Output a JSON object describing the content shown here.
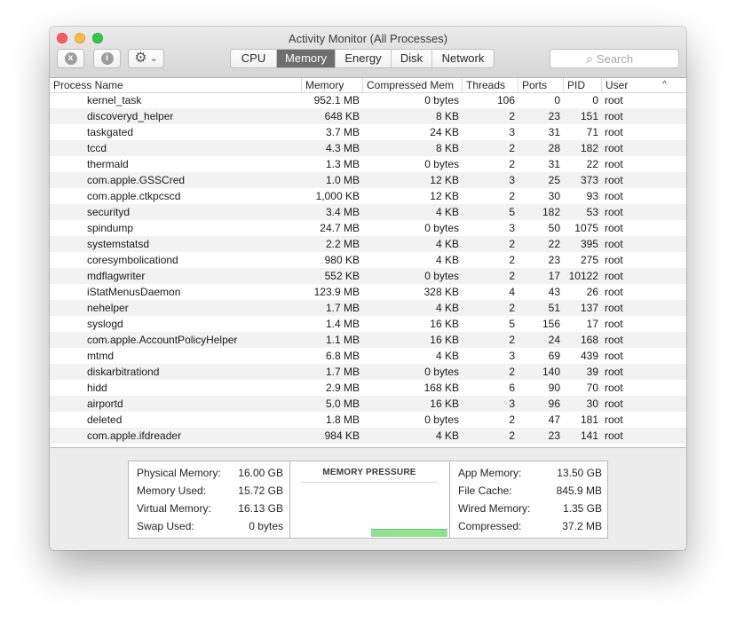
{
  "window": {
    "title": "Activity Monitor (All Processes)"
  },
  "toolbar": {
    "stop_icon": "x",
    "info_icon": "i",
    "gear_icon": "⚙",
    "gear_caret": "⌄",
    "tabs": [
      {
        "label": "CPU",
        "active": false
      },
      {
        "label": "Memory",
        "active": true
      },
      {
        "label": "Energy",
        "active": false
      },
      {
        "label": "Disk",
        "active": false
      },
      {
        "label": "Network",
        "active": false
      }
    ],
    "search": {
      "placeholder": "Search",
      "icon": "⌕"
    }
  },
  "table": {
    "columns": {
      "name": "Process Name",
      "memory": "Memory",
      "compressed": "Compressed Mem",
      "threads": "Threads",
      "ports": "Ports",
      "pid": "PID",
      "user": "User",
      "sort_indicator": "^"
    },
    "rows": [
      [
        "kernel_task",
        "952.1 MB",
        "0 bytes",
        "106",
        "0",
        "0",
        "root"
      ],
      [
        "discoveryd_helper",
        "648 KB",
        "8 KB",
        "2",
        "23",
        "151",
        "root"
      ],
      [
        "taskgated",
        "3.7 MB",
        "24 KB",
        "3",
        "31",
        "71",
        "root"
      ],
      [
        "tccd",
        "4.3 MB",
        "8 KB",
        "2",
        "28",
        "182",
        "root"
      ],
      [
        "thermald",
        "1.3 MB",
        "0 bytes",
        "2",
        "31",
        "22",
        "root"
      ],
      [
        "com.apple.GSSCred",
        "1.0 MB",
        "12 KB",
        "3",
        "25",
        "373",
        "root"
      ],
      [
        "com.apple.ctkpcscd",
        "1,000 KB",
        "12 KB",
        "2",
        "30",
        "93",
        "root"
      ],
      [
        "securityd",
        "3.4 MB",
        "4 KB",
        "5",
        "182",
        "53",
        "root"
      ],
      [
        "spindump",
        "24.7 MB",
        "0 bytes",
        "3",
        "50",
        "1075",
        "root"
      ],
      [
        "systemstatsd",
        "2.2 MB",
        "4 KB",
        "2",
        "22",
        "395",
        "root"
      ],
      [
        "coresymbolicationd",
        "980 KB",
        "4 KB",
        "2",
        "23",
        "275",
        "root"
      ],
      [
        "mdflagwriter",
        "552 KB",
        "0 bytes",
        "2",
        "17",
        "10122",
        "root"
      ],
      [
        "iStatMenusDaemon",
        "123.9 MB",
        "328 KB",
        "4",
        "43",
        "26",
        "root"
      ],
      [
        "nehelper",
        "1.7 MB",
        "4 KB",
        "2",
        "51",
        "137",
        "root"
      ],
      [
        "syslogd",
        "1.4 MB",
        "16 KB",
        "5",
        "156",
        "17",
        "root"
      ],
      [
        "com.apple.AccountPolicyHelper",
        "1.1 MB",
        "16 KB",
        "2",
        "24",
        "168",
        "root"
      ],
      [
        "mtmd",
        "6.8 MB",
        "4 KB",
        "3",
        "69",
        "439",
        "root"
      ],
      [
        "diskarbitrationd",
        "1.7 MB",
        "0 bytes",
        "2",
        "140",
        "39",
        "root"
      ],
      [
        "hidd",
        "2.9 MB",
        "168 KB",
        "6",
        "90",
        "70",
        "root"
      ],
      [
        "airportd",
        "5.0 MB",
        "16 KB",
        "3",
        "96",
        "30",
        "root"
      ],
      [
        "deleted",
        "1.8 MB",
        "0 bytes",
        "2",
        "47",
        "181",
        "root"
      ],
      [
        "com.apple.ifdreader",
        "984 KB",
        "4 KB",
        "2",
        "23",
        "141",
        "root"
      ]
    ]
  },
  "stats": {
    "left": [
      {
        "label": "Physical Memory:",
        "value": "16.00 GB"
      },
      {
        "label": "Memory Used:",
        "value": "15.72 GB"
      },
      {
        "label": "Virtual Memory:",
        "value": "16.13 GB"
      },
      {
        "label": "Swap Used:",
        "value": "0 bytes"
      }
    ],
    "memory_pressure": {
      "title": "MEMORY PRESSURE",
      "graph_color": "#8ee38f"
    },
    "right": [
      {
        "label": "App Memory:",
        "value": "13.50 GB"
      },
      {
        "label": "File Cache:",
        "value": "845.9 MB"
      },
      {
        "label": "Wired Memory:",
        "value": "1.35 GB"
      },
      {
        "label": "Compressed:",
        "value": "37.2 MB"
      }
    ]
  }
}
